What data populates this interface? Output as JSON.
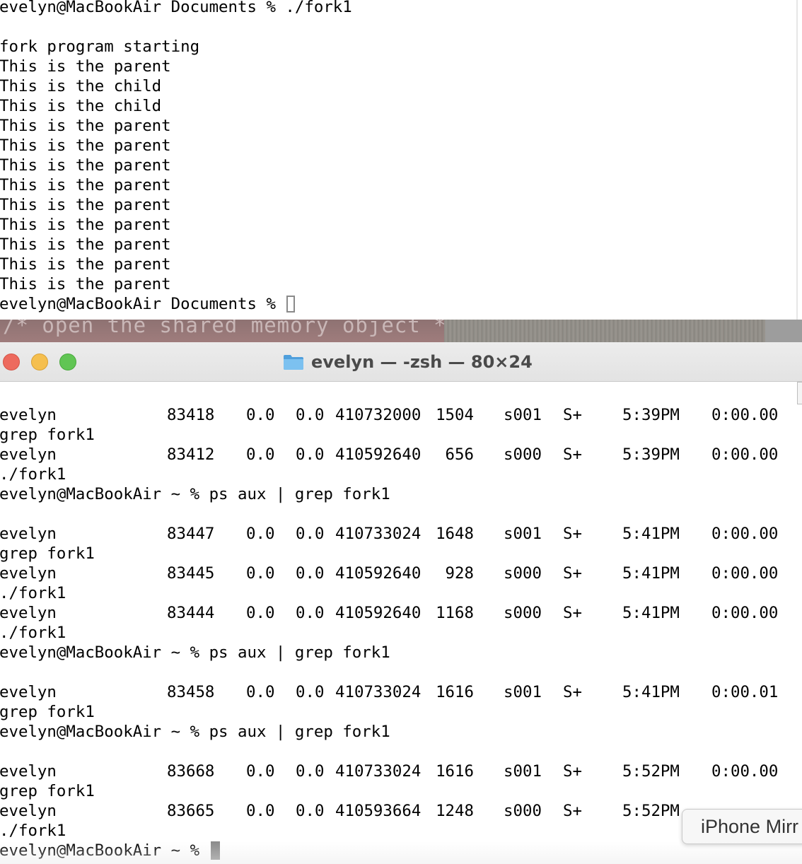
{
  "top_terminal": {
    "lines": [
      "evelyn@MacBookAir Documents % ./fork1",
      "",
      "fork program starting",
      "This is the parent",
      "This is the child",
      "This is the child",
      "This is the parent",
      "This is the parent",
      "This is the parent",
      "This is the parent",
      "This is the parent",
      "This is the parent",
      "This is the parent",
      "This is the parent",
      "This is the parent"
    ],
    "prompt": "evelyn@MacBookAir Documents % "
  },
  "background_code": {
    "text": "/* open the shared memory object */"
  },
  "main_window": {
    "title": "evelyn — -zsh — 80×24",
    "folder_icon": "folder-icon",
    "buttons": {
      "close": "close-button",
      "minimize": "minimize-button",
      "zoom": "zoom-button"
    }
  },
  "terminal": {
    "blocks": [
      {
        "command": null,
        "processes": [
          {
            "user": "evelyn",
            "pid": "83418",
            "cpu": "0.0",
            "mem": "0.0",
            "vsz": "410732000",
            "rss": "1504",
            "tt": "s001",
            "stat": "S+",
            "started": "5:39PM",
            "time": "0:00.00",
            "command": "grep fork1"
          },
          {
            "user": "evelyn",
            "pid": "83412",
            "cpu": "0.0",
            "mem": "0.0",
            "vsz": "410592640",
            "rss": "656",
            "tt": "s000",
            "stat": "S+",
            "started": "5:39PM",
            "time": "0:00.00",
            "command": "./fork1"
          }
        ]
      },
      {
        "command": "evelyn@MacBookAir ~ % ps aux | grep fork1",
        "processes": [
          {
            "user": "evelyn",
            "pid": "83447",
            "cpu": "0.0",
            "mem": "0.0",
            "vsz": "410733024",
            "rss": "1648",
            "tt": "s001",
            "stat": "S+",
            "started": "5:41PM",
            "time": "0:00.00",
            "command": "grep fork1"
          },
          {
            "user": "evelyn",
            "pid": "83445",
            "cpu": "0.0",
            "mem": "0.0",
            "vsz": "410592640",
            "rss": "928",
            "tt": "s000",
            "stat": "S+",
            "started": "5:41PM",
            "time": "0:00.00",
            "command": "./fork1"
          },
          {
            "user": "evelyn",
            "pid": "83444",
            "cpu": "0.0",
            "mem": "0.0",
            "vsz": "410592640",
            "rss": "1168",
            "tt": "s000",
            "stat": "S+",
            "started": "5:41PM",
            "time": "0:00.00",
            "command": "./fork1"
          }
        ]
      },
      {
        "command": "evelyn@MacBookAir ~ % ps aux | grep fork1",
        "processes": [
          {
            "user": "evelyn",
            "pid": "83458",
            "cpu": "0.0",
            "mem": "0.0",
            "vsz": "410733024",
            "rss": "1616",
            "tt": "s001",
            "stat": "S+",
            "started": "5:41PM",
            "time": "0:00.01",
            "command": "grep fork1"
          }
        ]
      },
      {
        "command": "evelyn@MacBookAir ~ % ps aux | grep fork1",
        "processes": [
          {
            "user": "evelyn",
            "pid": "83668",
            "cpu": "0.0",
            "mem": "0.0",
            "vsz": "410733024",
            "rss": "1616",
            "tt": "s001",
            "stat": "S+",
            "started": "5:52PM",
            "time": "0:00.00",
            "command": "grep fork1"
          },
          {
            "user": "evelyn",
            "pid": "83665",
            "cpu": "0.0",
            "mem": "0.0",
            "vsz": "410593664",
            "rss": "1248",
            "tt": "s000",
            "stat": "S+",
            "started": "5:52PM",
            "time": "",
            "command": "./fork1"
          }
        ]
      }
    ],
    "prompt": "evelyn@MacBookAir ~ % "
  },
  "tooltip": {
    "text": "iPhone Mirr"
  },
  "colors": {
    "close": "#ed6a5e",
    "minimize": "#f5bf4f",
    "zoom": "#61c554",
    "folder": "#5aaeea",
    "cursor": "#8a8a8a"
  }
}
